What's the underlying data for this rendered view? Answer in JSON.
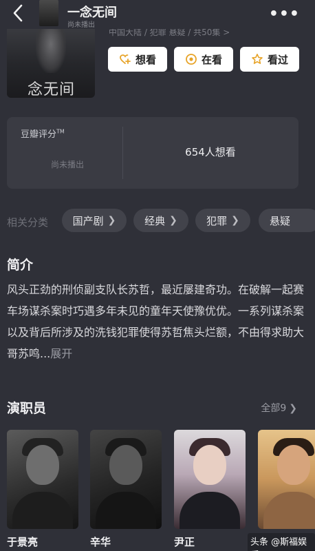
{
  "header": {
    "title": "一念无间",
    "subtitle": "尚未播出",
    "more_label": "•••"
  },
  "poster": {
    "title": "念无间"
  },
  "meta": {
    "line": "中国大陆 / 犯罪 悬疑 / 共50集 >"
  },
  "actions": {
    "want_label": "想看",
    "watching_label": "在看",
    "watched_label": "看过"
  },
  "rating": {
    "label": "豆瓣评分",
    "tm": "TM",
    "status": "尚未播出",
    "want_count": "654人想看"
  },
  "categories": {
    "label": "相关分类",
    "items": [
      "国产剧",
      "经典",
      "犯罪",
      "悬疑"
    ]
  },
  "intro": {
    "title": "简介",
    "text": "风头正劲的刑侦副支队长苏哲，最近屡建奇功。在破解一起赛车场谋杀案时巧遇多年未见的童年天使豫优优。一系列谋杀案以及背后所涉及的洗钱犯罪使得苏哲焦头烂额，不由得求助大哥苏鸣...",
    "expand": "展开"
  },
  "cast": {
    "title": "演职员",
    "all_label": "全部9",
    "members": [
      {
        "name": "于景亮"
      },
      {
        "name": "辛华"
      },
      {
        "name": "尹正"
      },
      {
        "name": ""
      }
    ]
  },
  "watermark": "头条 @斯福娱乐",
  "colors": {
    "background": "#2f3038",
    "card": "#3a3b43",
    "chip": "#42434b",
    "button": "#ffffff"
  }
}
